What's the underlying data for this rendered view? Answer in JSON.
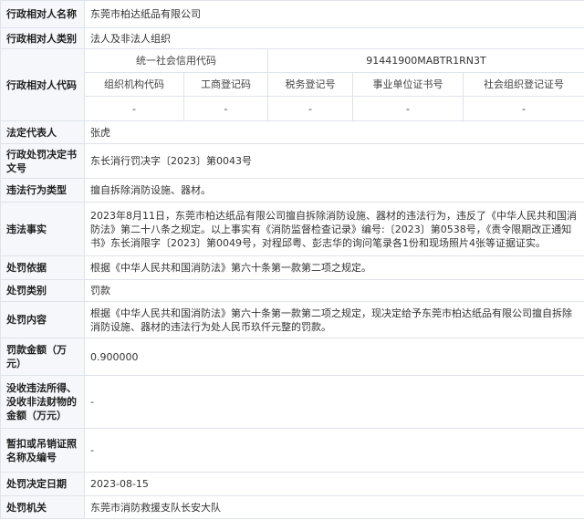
{
  "rows": {
    "party_name": {
      "label": "行政相对人名称",
      "value": "东莞市柏达纸品有限公司"
    },
    "party_type": {
      "label": "行政相对人类别",
      "value": "法人及非法人组织"
    },
    "party_code": {
      "label": "行政相对人代码",
      "usc_label": "统一社会信用代码",
      "usc_value": "91441900MABTR1RN3T",
      "headers": [
        "组织机构代码",
        "工商登记码",
        "税务登记号",
        "事业单位证书号",
        "社会组织登记证号"
      ],
      "values": [
        "-",
        "-",
        "-",
        "-",
        "-"
      ]
    },
    "legal_rep": {
      "label": "法定代表人",
      "value": "张虎"
    },
    "decision_no": {
      "label": "行政处罚决定书文号",
      "value": "东长消行罚决字〔2023〕第0043号"
    },
    "violation_type": {
      "label": "违法行为类型",
      "value": "擅自拆除消防设施、器材。"
    },
    "violation_facts": {
      "label": "违法事实",
      "value": "2023年8月11日，东莞市柏达纸品有限公司擅自拆除消防设施、器材的违法行为，违反了《中华人民共和国消防法》第二十八条之规定。以上事实有《消防监督检查记录》编号:〔2023〕第0538号，《责令限期改正通知书》东长消限字〔2023〕第0049号，对程邱粤、彭志华的询问笔录各1份和现场照片4张等证据证实。"
    },
    "basis": {
      "label": "处罚依据",
      "value": "根据《中华人民共和国消防法》第六十条第一款第二项之规定。"
    },
    "penalty_type": {
      "label": "处罚类别",
      "value": "罚款"
    },
    "penalty_content": {
      "label": "处罚内容",
      "value": "根据《中华人民共和国消防法》第六十条第一款第二项之规定，现决定给予东莞市柏达纸品有限公司擅自拆除消防设施、器材的违法行为处人民币玖仟元整的罚款。"
    },
    "fine_amount": {
      "label": "罚款金额（万元）",
      "value": "0.900000"
    },
    "confiscation": {
      "label": "没收违法所得、没收非法财物的金额（万元）",
      "value": "-"
    },
    "license": {
      "label": "暂扣或吊销证照名称及编号",
      "value": "-"
    },
    "decision_date": {
      "label": "处罚决定日期",
      "value": "2023-08-15"
    },
    "authority": {
      "label": "处罚机关",
      "value": "东莞市消防救援支队长安大队"
    }
  }
}
